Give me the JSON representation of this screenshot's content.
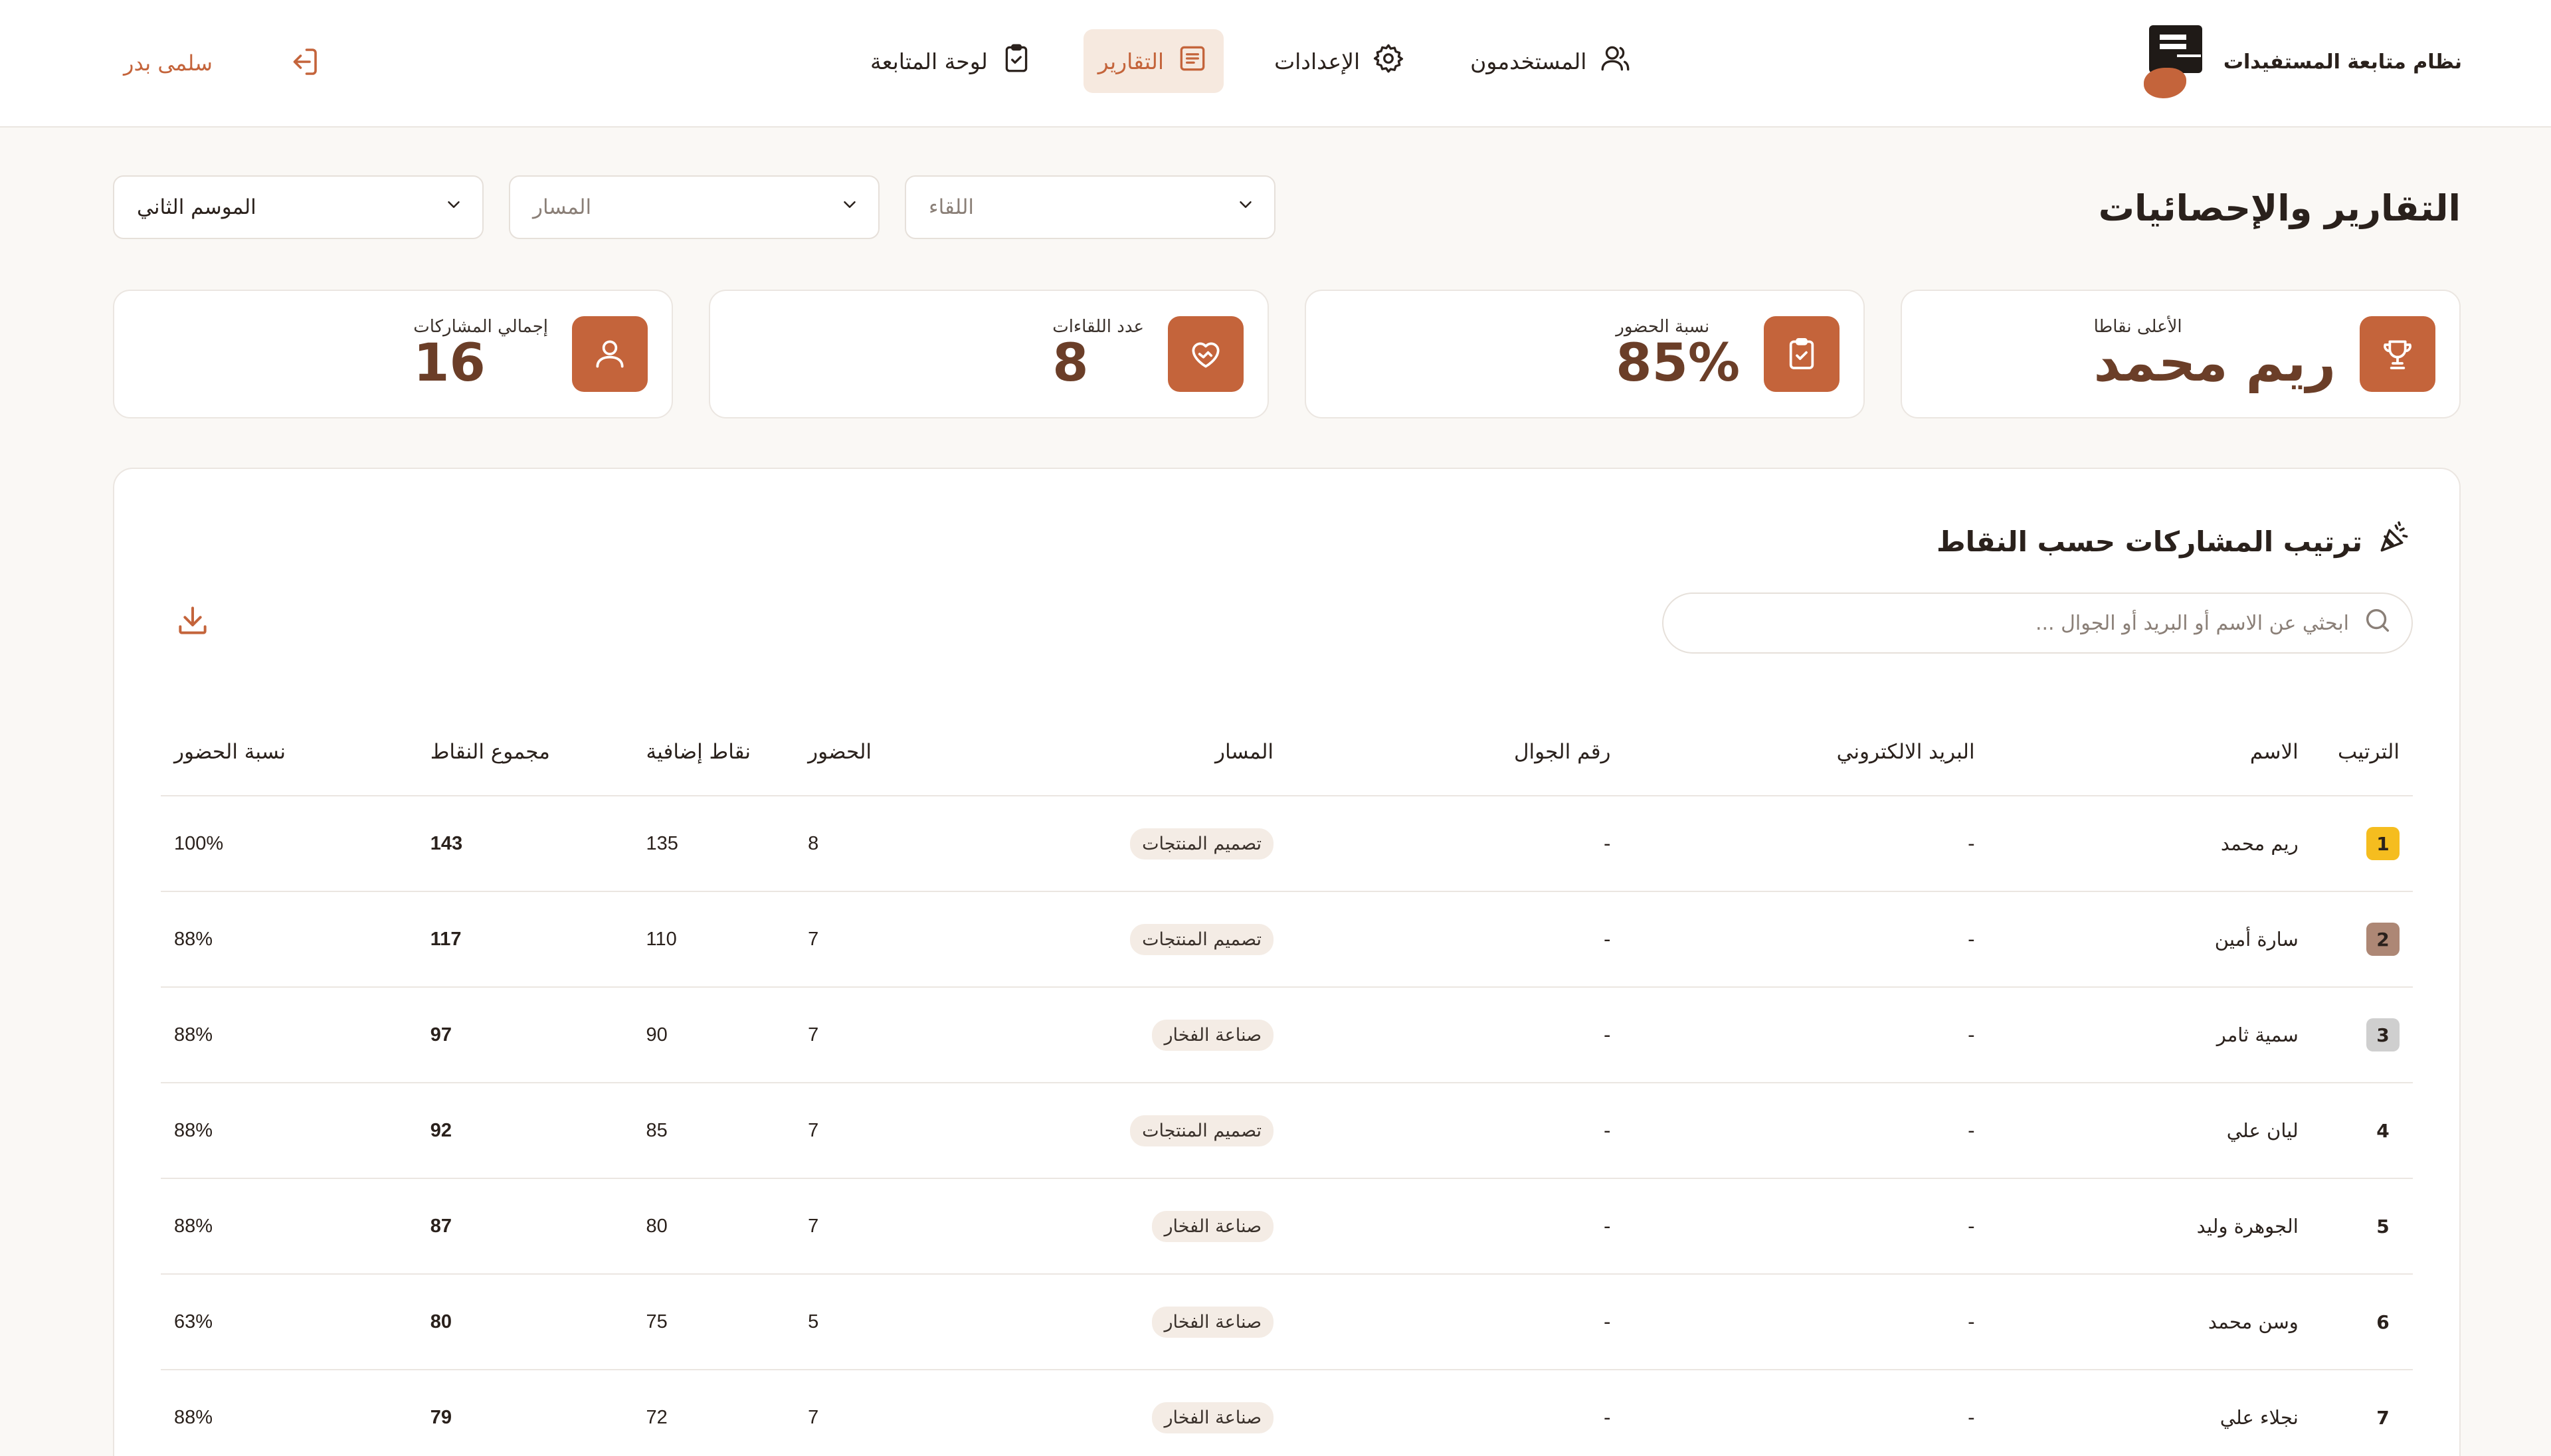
{
  "brand": {
    "name": "نظام متابعة المستفيدات"
  },
  "nav": [
    {
      "label": "لوحة المتابعة",
      "icon": "clipboard-icon",
      "active": false
    },
    {
      "label": "التقارير",
      "icon": "report-icon",
      "active": true
    },
    {
      "label": "الإعدادات",
      "icon": "gear-icon",
      "active": false
    },
    {
      "label": "المستخدمون",
      "icon": "users-icon",
      "active": false
    }
  ],
  "user": {
    "name": "سلمى بدر"
  },
  "page": {
    "title": "التقارير والإحصائيات"
  },
  "filters": {
    "season": "الموسم الثاني",
    "track_placeholder": "المسار",
    "meeting_placeholder": "اللقاء"
  },
  "stats": [
    {
      "label": "إجمالي المشاركات",
      "value": "16",
      "icon": "user-icon"
    },
    {
      "label": "عدد اللقاءات",
      "value": "8",
      "icon": "handshake-heart-icon"
    },
    {
      "label": "نسبة الحضور",
      "value": "85%",
      "icon": "clipboard-check-icon"
    },
    {
      "label": "الأعلى نقاطا",
      "value": "ريم محمد",
      "icon": "trophy-icon"
    }
  ],
  "ranking": {
    "title": "ترتيب المشاركات حسب النقاط",
    "search_placeholder": "ابحثي عن الاسم أو البريد أو الجوال ...",
    "columns": [
      "الترتيب",
      "الاسم",
      "البريد الالكتروني",
      "رقم الجوال",
      "المسار",
      "الحضور",
      "نقاط إضافية",
      "مجموع النقاط",
      "نسبة الحضور"
    ],
    "rows": [
      {
        "rank": "1",
        "name": "ريم محمد",
        "email": "-",
        "phone": "-",
        "track": "تصميم المنتجات",
        "attendance": "8",
        "bonus": "135",
        "total": "143",
        "rate": "100%"
      },
      {
        "rank": "2",
        "name": "سارة أمين",
        "email": "-",
        "phone": "-",
        "track": "تصميم المنتجات",
        "attendance": "7",
        "bonus": "110",
        "total": "117",
        "rate": "88%"
      },
      {
        "rank": "3",
        "name": "سمية ثامر",
        "email": "-",
        "phone": "-",
        "track": "صناعة الفخار",
        "attendance": "7",
        "bonus": "90",
        "total": "97",
        "rate": "88%"
      },
      {
        "rank": "4",
        "name": "ليان علي",
        "email": "-",
        "phone": "-",
        "track": "تصميم المنتجات",
        "attendance": "7",
        "bonus": "85",
        "total": "92",
        "rate": "88%"
      },
      {
        "rank": "5",
        "name": "الجوهرة وليد",
        "email": "-",
        "phone": "-",
        "track": "صناعة الفخار",
        "attendance": "7",
        "bonus": "80",
        "total": "87",
        "rate": "88%"
      },
      {
        "rank": "6",
        "name": "وسن محمد",
        "email": "-",
        "phone": "-",
        "track": "صناعة الفخار",
        "attendance": "5",
        "bonus": "75",
        "total": "80",
        "rate": "63%"
      },
      {
        "rank": "7",
        "name": "نجلاء علي",
        "email": "-",
        "phone": "-",
        "track": "صناعة الفخار",
        "attendance": "7",
        "bonus": "72",
        "total": "79",
        "rate": "88%"
      }
    ]
  },
  "colors": {
    "accent": "#c4643b",
    "accent_soft": "#f6e9df",
    "dark_value": "#6b3e28",
    "gold": "#f5bd1f",
    "bronze": "#ad8775",
    "silver": "#cfcfcf"
  }
}
